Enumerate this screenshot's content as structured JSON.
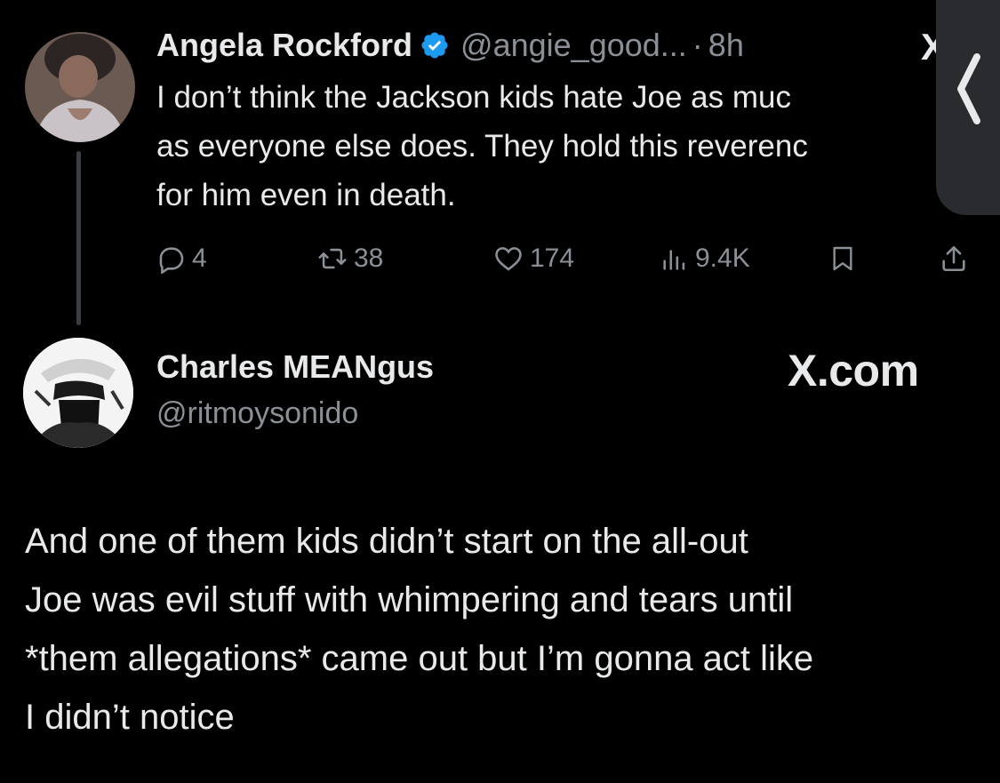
{
  "tweet": {
    "author_name": "Angela Rockford",
    "handle": "@angie_good...",
    "separator": "·",
    "time": "8h",
    "text": "I don’t think the Jackson kids hate Joe as muc\nas everyone else does. They hold this reverenc\nfor him even in death.",
    "stats": {
      "replies": "4",
      "reposts": "38",
      "likes": "174",
      "views": "9.4K"
    }
  },
  "quote": {
    "author_name": "Charles MEANgus",
    "handle": "@ritmoysonido",
    "site_label": "X.com",
    "text": "And one of them kids didn’t start on the all-out\nJoe was evil stuff with whimpering and tears until\n*them allegations* came out but I’m gonna act like\nI didn’t notice"
  },
  "more_glyph": "X",
  "icons": {
    "verified": "verified-badge-icon",
    "reply": "reply-icon",
    "repost": "repost-icon",
    "like": "heart-icon",
    "views": "views-icon",
    "bookmark": "bookmark-icon",
    "share": "share-icon",
    "side": "chevron-left-icon"
  },
  "colors": {
    "background": "#000000",
    "text": "#e7e9ea",
    "muted": "#8b9097",
    "verified": "#1d9bf0"
  }
}
